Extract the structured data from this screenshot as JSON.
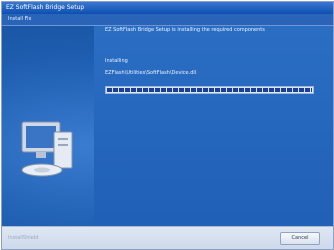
{
  "window": {
    "title": "EZ SoftFlash Bridge Setup"
  },
  "tab": {
    "label": "Install Fix"
  },
  "content": {
    "status": "EZ SoftFlash Bridge Setup is installing the required components",
    "phase": "Installing",
    "file": "EZFlash\\Utilities\\SoftFlash\\Device.dll",
    "progress_percent": 100
  },
  "footer": {
    "brand": "InstallShield",
    "cancel_label": "Cancel"
  },
  "colors": {
    "window_bg": "#1e5aa8",
    "progress_fill": "#1a3f9a"
  },
  "icons": {
    "illustration": "computer-icon"
  }
}
